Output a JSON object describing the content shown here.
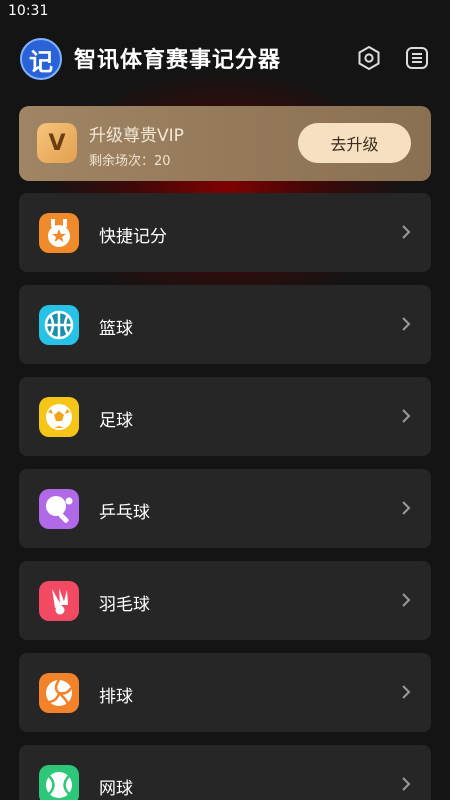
{
  "status_bar": {
    "time": "10:31"
  },
  "header": {
    "logo_char": "记",
    "title": "智讯体育赛事记分器",
    "icons": [
      "hexagon-settings-icon",
      "menu-icon"
    ]
  },
  "vip": {
    "badge": "V",
    "title": "升级尊贵VIP",
    "remaining": "剩余场次：20",
    "button": "去升级"
  },
  "sports": [
    {
      "label": "快捷记分",
      "icon": "medal-star-icon",
      "color": "#f08a2a"
    },
    {
      "label": "篮球",
      "icon": "basketball-icon",
      "color": "#27c3e6"
    },
    {
      "label": "足球",
      "icon": "soccer-ball-icon",
      "color": "#f5c518"
    },
    {
      "label": "乒乓球",
      "icon": "ping-pong-icon",
      "color": "#b06ae8"
    },
    {
      "label": "羽毛球",
      "icon": "badminton-icon",
      "color": "#f24a63"
    },
    {
      "label": "排球",
      "icon": "volleyball-icon",
      "color": "#f3832a"
    },
    {
      "label": "网球",
      "icon": "tennis-ball-icon",
      "color": "#2dc77a"
    }
  ]
}
